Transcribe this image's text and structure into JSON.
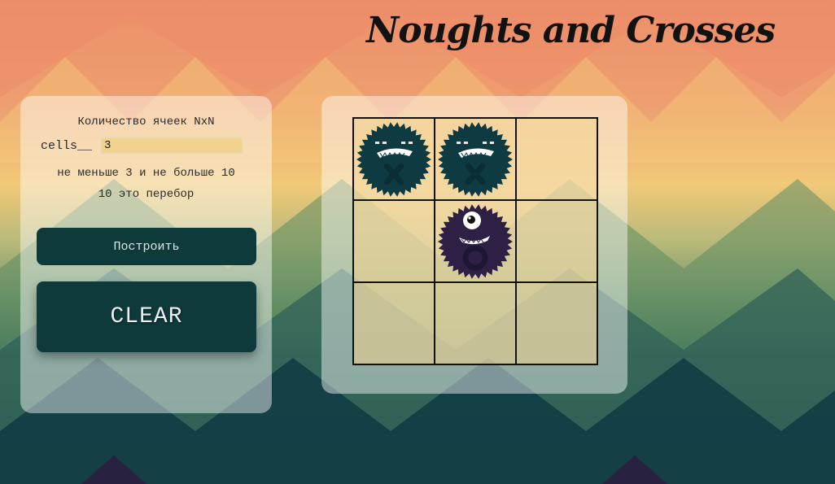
{
  "title": "Noughts and Crosses",
  "controls": {
    "cells_caption": "Количество ячеек NxN",
    "cells_label": "cells__",
    "cells_value": "3",
    "hint_range": "не меньше 3 и не больше 10",
    "hint_over": "10 это перебор",
    "build_label": "Построить",
    "clear_label": "CLEAR"
  },
  "board": {
    "size": 3,
    "cells": [
      "X",
      "X",
      "",
      "",
      "O",
      "",
      "",
      "",
      ""
    ]
  },
  "colors": {
    "cross_monster": "#0e3a42",
    "nought_monster": "#2e1f45",
    "button_bg": "#0f3a3c"
  }
}
